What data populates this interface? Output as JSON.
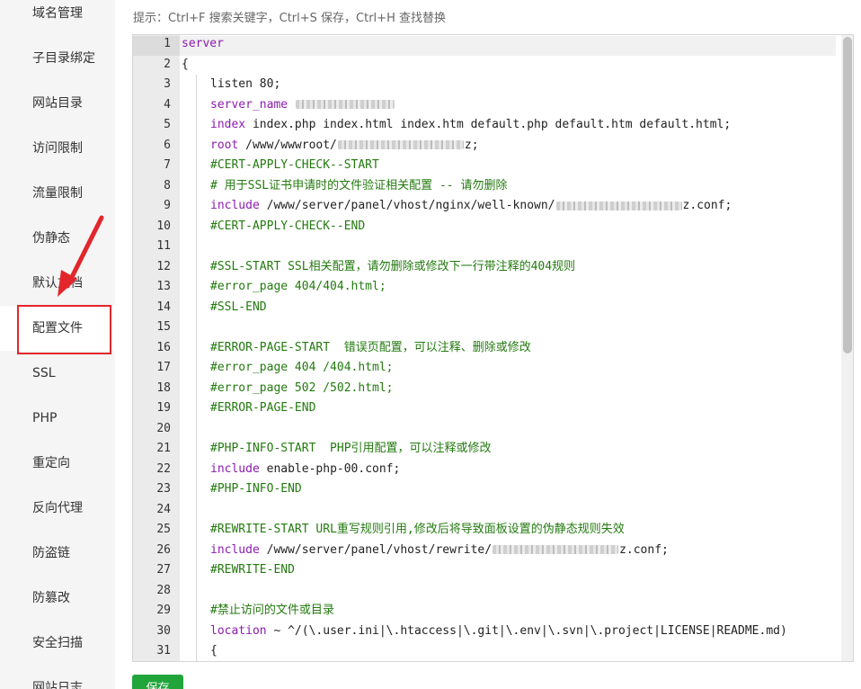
{
  "sidebar": {
    "items": [
      {
        "label": "域名管理"
      },
      {
        "label": "子目录绑定"
      },
      {
        "label": "网站目录"
      },
      {
        "label": "访问限制"
      },
      {
        "label": "流量限制"
      },
      {
        "label": "伪静态"
      },
      {
        "label": "默认文档"
      },
      {
        "label": "配置文件",
        "active": true
      },
      {
        "label": "SSL"
      },
      {
        "label": "PHP"
      },
      {
        "label": "重定向"
      },
      {
        "label": "反向代理"
      },
      {
        "label": "防盗链"
      },
      {
        "label": "防篡改"
      },
      {
        "label": "安全扫描"
      },
      {
        "label": "网站日志"
      }
    ]
  },
  "hint": "提示：Ctrl+F 搜索关键字，Ctrl+S 保存，Ctrl+H 查找替换",
  "editor": {
    "lines": [
      {
        "n": "1",
        "indent": false,
        "parts": [
          {
            "t": "server",
            "c": "kw"
          }
        ]
      },
      {
        "n": "2",
        "indent": false,
        "parts": [
          {
            "t": "{",
            "c": ""
          }
        ]
      },
      {
        "n": "3",
        "indent": true,
        "parts": [
          {
            "t": "listen 80;",
            "c": ""
          }
        ]
      },
      {
        "n": "4",
        "indent": true,
        "parts": [
          {
            "t": "server_name ",
            "c": "kw"
          },
          {
            "blur": 110
          }
        ]
      },
      {
        "n": "5",
        "indent": true,
        "parts": [
          {
            "t": "index",
            "c": "kw"
          },
          {
            "t": " index.php index.html index.htm default.php default.htm default.html;",
            "c": ""
          }
        ]
      },
      {
        "n": "6",
        "indent": true,
        "parts": [
          {
            "t": "root",
            "c": "kw"
          },
          {
            "t": " /www/wwwroot/",
            "c": ""
          },
          {
            "blur": 140
          },
          {
            "t": "z;",
            "c": ""
          }
        ]
      },
      {
        "n": "7",
        "indent": true,
        "parts": [
          {
            "t": "#CERT-APPLY-CHECK--START",
            "c": "cm"
          }
        ]
      },
      {
        "n": "8",
        "indent": true,
        "parts": [
          {
            "t": "# 用于SSL证书申请时的文件验证相关配置 -- 请勿删除",
            "c": "cm"
          }
        ]
      },
      {
        "n": "9",
        "indent": true,
        "parts": [
          {
            "t": "include",
            "c": "kw"
          },
          {
            "t": " /www/server/panel/vhost/nginx/well-known/",
            "c": ""
          },
          {
            "blur": 140
          },
          {
            "t": "z.conf;",
            "c": ""
          }
        ]
      },
      {
        "n": "10",
        "indent": true,
        "parts": [
          {
            "t": "#CERT-APPLY-CHECK--END",
            "c": "cm"
          }
        ]
      },
      {
        "n": "11",
        "indent": true,
        "parts": []
      },
      {
        "n": "12",
        "indent": true,
        "parts": [
          {
            "t": "#SSL-START SSL相关配置，请勿删除或修改下一行带注释的404规则",
            "c": "cm"
          }
        ]
      },
      {
        "n": "13",
        "indent": true,
        "parts": [
          {
            "t": "#error_page 404/404.html;",
            "c": "cm"
          }
        ]
      },
      {
        "n": "14",
        "indent": true,
        "parts": [
          {
            "t": "#SSL-END",
            "c": "cm"
          }
        ]
      },
      {
        "n": "15",
        "indent": true,
        "parts": []
      },
      {
        "n": "16",
        "indent": true,
        "parts": [
          {
            "t": "#ERROR-PAGE-START  错误页配置，可以注释、删除或修改",
            "c": "cm"
          }
        ]
      },
      {
        "n": "17",
        "indent": true,
        "parts": [
          {
            "t": "#error_page 404 /404.html;",
            "c": "cm"
          }
        ]
      },
      {
        "n": "18",
        "indent": true,
        "parts": [
          {
            "t": "#error_page 502 /502.html;",
            "c": "cm"
          }
        ]
      },
      {
        "n": "19",
        "indent": true,
        "parts": [
          {
            "t": "#ERROR-PAGE-END",
            "c": "cm"
          }
        ]
      },
      {
        "n": "20",
        "indent": true,
        "parts": []
      },
      {
        "n": "21",
        "indent": true,
        "parts": [
          {
            "t": "#PHP-INFO-START  PHP引用配置，可以注释或修改",
            "c": "cm"
          }
        ]
      },
      {
        "n": "22",
        "indent": true,
        "parts": [
          {
            "t": "include",
            "c": "kw"
          },
          {
            "t": " enable-php-00.conf;",
            "c": ""
          }
        ]
      },
      {
        "n": "23",
        "indent": true,
        "parts": [
          {
            "t": "#PHP-INFO-END",
            "c": "cm"
          }
        ]
      },
      {
        "n": "24",
        "indent": true,
        "parts": []
      },
      {
        "n": "25",
        "indent": true,
        "parts": [
          {
            "t": "#REWRITE-START URL重写规则引用,修改后将导致面板设置的伪静态规则失效",
            "c": "cm"
          }
        ]
      },
      {
        "n": "26",
        "indent": true,
        "parts": [
          {
            "t": "include",
            "c": "kw"
          },
          {
            "t": " /www/server/panel/vhost/rewrite/",
            "c": ""
          },
          {
            "blur": 140
          },
          {
            "t": "z.conf;",
            "c": ""
          }
        ]
      },
      {
        "n": "27",
        "indent": true,
        "parts": [
          {
            "t": "#REWRITE-END",
            "c": "cm"
          }
        ]
      },
      {
        "n": "28",
        "indent": true,
        "parts": []
      },
      {
        "n": "29",
        "indent": true,
        "parts": [
          {
            "t": "#禁止访问的文件或目录",
            "c": "cm"
          }
        ]
      },
      {
        "n": "30",
        "indent": true,
        "parts": [
          {
            "t": "location",
            "c": "kw"
          },
          {
            "t": " ~ ^/(\\.user.ini|\\.htaccess|\\.git|\\.env|\\.svn|\\.project|LICENSE|README.md)",
            "c": ""
          }
        ]
      },
      {
        "n": "31",
        "indent": true,
        "parts": [
          {
            "t": "{",
            "c": ""
          }
        ]
      }
    ]
  },
  "save_label": "保存",
  "colors": {
    "accent": "#20a53a",
    "annotation": "#e3262c",
    "keyword": "#8c1bb0",
    "comment": "#237a0f"
  }
}
